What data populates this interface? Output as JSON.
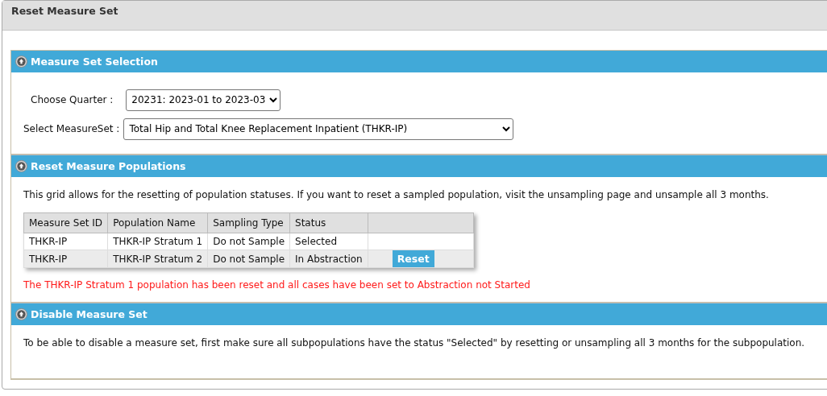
{
  "page_title": "Reset Measure Set",
  "sections": [
    {
      "kind": "selection",
      "title": "Measure Set Selection",
      "expanded": true,
      "fields": [
        {
          "label": "Choose Quarter :",
          "value": "20231: 2023-01 to 2023-03"
        },
        {
          "label": "Select MeasureSet :",
          "value": "Total Hip and Total Knee Replacement Inpatient (THKR-IP)"
        }
      ]
    },
    {
      "kind": "populations",
      "title": "Reset Measure Populations",
      "expanded": true,
      "intro": "This grid allows for the resetting of population statuses. If you want to reset a sampled population, visit the unsampling page and unsample all 3 months.",
      "table": {
        "columns": [
          "Measure Set ID",
          "Population Name",
          "Sampling Type",
          "Status"
        ],
        "rows": [
          {
            "cells": [
              "THKR-IP",
              "THKR-IP Stratum 1",
              "Do not Sample",
              "Selected"
            ]
          },
          {
            "cells": [
              "THKR-IP",
              "THKR-IP Stratum 2",
              "Do not Sample",
              "In Abstraction"
            ],
            "action": "Reset"
          }
        ]
      },
      "message": "The THKR-IP Stratum 1 population has been reset and all cases have been set to Abstraction not Started"
    },
    {
      "kind": "disable",
      "title": "Disable Measure Set",
      "expanded": true,
      "text": "To be able to disable a measure set, first make sure all subpopulations have the status \"Selected\" by resetting or unsampling all 3 months for the subpopulation."
    }
  ]
}
